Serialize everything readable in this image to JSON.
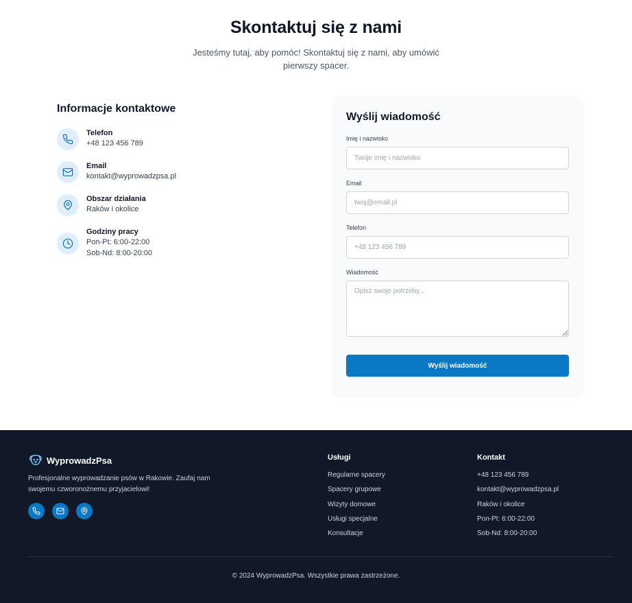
{
  "hero": {
    "title": "Skontaktuj się z nami",
    "subtitle": "Jesteśmy tutaj, aby pomóc! Skontaktuj się z nami, aby umówić pierwszy spacer."
  },
  "info": {
    "heading": "Informacje kontaktowe",
    "phone": {
      "label": "Telefon",
      "value": "+48 123 456 789",
      "icon": "phone-icon"
    },
    "email": {
      "label": "Email",
      "value": "kontakt@wyprowadzpsa.pl",
      "icon": "mail-icon"
    },
    "area": {
      "label": "Obszar działania",
      "value": "Raków i okolice",
      "icon": "map-pin-icon"
    },
    "hours": {
      "label": "Godziny pracy",
      "weekdays": "Pon-Pt: 6:00-22:00",
      "weekend": "Sob-Nd: 8:00-20:00",
      "icon": "clock-icon"
    }
  },
  "form": {
    "heading": "Wyślij wiadomość",
    "name": {
      "label": "Imię i nazwisko",
      "placeholder": "Twoje imię i nazwisko",
      "value": ""
    },
    "email": {
      "label": "Email",
      "placeholder": "twoj@email.pl",
      "value": ""
    },
    "phone": {
      "label": "Telefon",
      "placeholder": "+48 123 456 789",
      "value": ""
    },
    "message": {
      "label": "Wiadomość",
      "placeholder": "Opisz swoje potrzeby...",
      "value": ""
    },
    "submit_label": "Wyślij wiadomość"
  },
  "footer": {
    "brand": "WyprowadzPsa",
    "description": "Profesjonalne wyprowadzanie psów w Rakowie. Zaufaj nam swojemu czworonożnemu przyjacielowi!",
    "socials": [
      "phone-icon",
      "mail-icon",
      "map-pin-icon"
    ],
    "services": {
      "heading": "Usługi",
      "items": [
        "Regularne spacery",
        "Spacery grupowe",
        "Wizyty domowe",
        "Usługi specjalne",
        "Konsultacje"
      ]
    },
    "contact": {
      "heading": "Kontakt",
      "items": [
        "+48 123 456 789",
        "kontakt@wyprowadzpsa.pl",
        "Raków i okolice",
        "Pon-Pt: 6:00-22:00",
        "Sob-Nd: 8:00-20:00"
      ]
    },
    "copyright": "© 2024 WyprowadzPsa. Wszystkie prawa zastrzeżone."
  },
  "colors": {
    "accent": "#0a78c4",
    "icon_bg": "#e0eefb",
    "footer_bg": "#111827"
  }
}
